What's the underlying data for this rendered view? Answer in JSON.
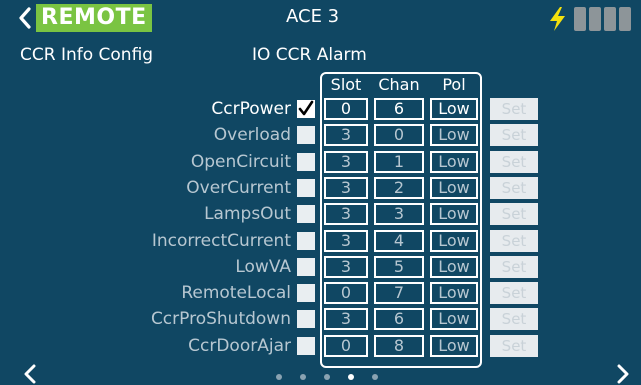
{
  "header": {
    "remote_label": "REMOTE",
    "device_title": "ACE 3",
    "status_icon": "bolt-icon",
    "signal_bar_count": 4
  },
  "subheader": {
    "left": "CCR Info Config",
    "center": "IO CCR Alarm"
  },
  "grid": {
    "columns": [
      "Slot",
      "Chan",
      "Pol"
    ],
    "rows": [
      {
        "label": "CcrPower",
        "checked": true,
        "slot": "0",
        "chan": "6",
        "pol": "Low",
        "set": "Set"
      },
      {
        "label": "Overload",
        "checked": false,
        "slot": "3",
        "chan": "0",
        "pol": "Low",
        "set": "Set"
      },
      {
        "label": "OpenCircuit",
        "checked": false,
        "slot": "3",
        "chan": "1",
        "pol": "Low",
        "set": "Set"
      },
      {
        "label": "OverCurrent",
        "checked": false,
        "slot": "3",
        "chan": "2",
        "pol": "Low",
        "set": "Set"
      },
      {
        "label": "LampsOut",
        "checked": false,
        "slot": "3",
        "chan": "3",
        "pol": "Low",
        "set": "Set"
      },
      {
        "label": "IncorrectCurrent",
        "checked": false,
        "slot": "3",
        "chan": "4",
        "pol": "Low",
        "set": "Set"
      },
      {
        "label": "LowVA",
        "checked": false,
        "slot": "3",
        "chan": "5",
        "pol": "Low",
        "set": "Set"
      },
      {
        "label": "RemoteLocal",
        "checked": false,
        "slot": "0",
        "chan": "7",
        "pol": "Low",
        "set": "Set"
      },
      {
        "label": "CcrProShutdown",
        "checked": false,
        "slot": "3",
        "chan": "6",
        "pol": "Low",
        "set": "Set"
      },
      {
        "label": "CcrDoorAjar",
        "checked": false,
        "slot": "0",
        "chan": "8",
        "pol": "Low",
        "set": "Set"
      }
    ]
  },
  "footer": {
    "prev_icon": "chevron-left-icon",
    "next_icon": "chevron-right-icon",
    "page_count": 5,
    "current_page": 4
  },
  "colors": {
    "background": "#104763",
    "accent_green": "#7ac442",
    "bolt_yellow": "#f4e10d",
    "inactive_text": "#b7c7d1",
    "signal_bar": "#8d9599"
  }
}
